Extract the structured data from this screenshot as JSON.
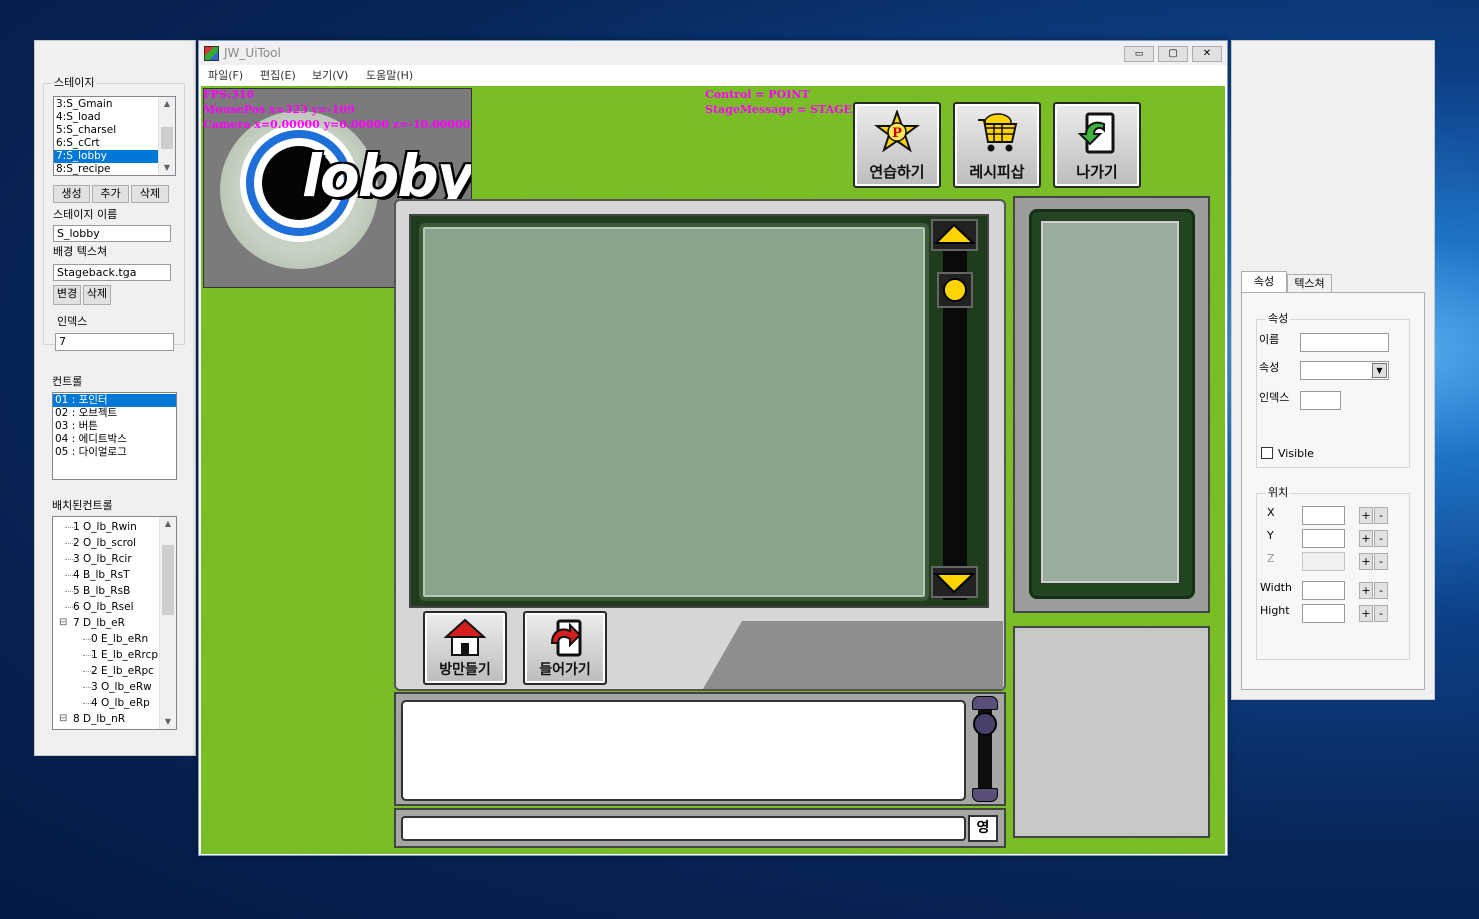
{
  "left_panel": {
    "stage_group_title": "스테이지",
    "stage_list": [
      "3:S_Gmain",
      "4:S_load",
      "5:S_charsel",
      "6:S_cCrt",
      "7:S_lobby",
      "8:S_recipe"
    ],
    "stage_selected_index": 4,
    "btn_create": "생성",
    "btn_add": "추가",
    "btn_delete": "삭제",
    "stage_name_label": "스테이지 이름",
    "stage_name_value": "S_lobby",
    "bg_texture_label": "배경 텍스쳐",
    "bg_texture_value": "Stageback.tga",
    "btn_change": "변경",
    "btn_delete2": "삭제",
    "index_label": "인덱스",
    "index_value": "7",
    "control_label": "컨트롤",
    "control_list": [
      "01 : 포인터",
      "02 : 오브젝트",
      "03 : 버튼",
      "04 : 에디트박스",
      "05 : 다이얼로그"
    ],
    "control_selected_index": 0,
    "placed_label": "배치된컨트롤",
    "tree": [
      {
        "text": "1 O_lb_Rwin",
        "level": 1,
        "expand": ""
      },
      {
        "text": "2 O_lb_scrol",
        "level": 1,
        "expand": ""
      },
      {
        "text": "3 O_lb_Rcir",
        "level": 1,
        "expand": ""
      },
      {
        "text": "4 B_lb_RsT",
        "level": 1,
        "expand": ""
      },
      {
        "text": "5 B_lb_RsB",
        "level": 1,
        "expand": ""
      },
      {
        "text": "6 O_lb_Rsel",
        "level": 1,
        "expand": ""
      },
      {
        "text": "7 D_lb_eR",
        "level": 1,
        "expand": "⊟"
      },
      {
        "text": "0 E_lb_eRn",
        "level": 2,
        "expand": ""
      },
      {
        "text": "1 E_lb_eRrcp",
        "level": 2,
        "expand": ""
      },
      {
        "text": "2 E_lb_eRpc",
        "level": 2,
        "expand": ""
      },
      {
        "text": "3 O_lb_eRw",
        "level": 2,
        "expand": ""
      },
      {
        "text": "4 O_lb_eRp",
        "level": 2,
        "expand": ""
      },
      {
        "text": "8 D_lb_nR",
        "level": 1,
        "expand": "⊟"
      }
    ]
  },
  "main_window": {
    "title": "JW_UiTool",
    "menu": [
      "파일(F)",
      "편집(E)",
      "보기(V)",
      "도움말(H)"
    ],
    "ctrl_min": "▭",
    "ctrl_max": "▢",
    "ctrl_close": "✕"
  },
  "canvas": {
    "debug_fps": "FPS:316",
    "debug_mouse": "MousePos x=323 y=-109",
    "debug_camera": "Camera x=0.00000 y=0.00000 z=-10.00000",
    "debug_control": "Control = POINT",
    "debug_stage_msg": "StageMessage = STAGEMSG_NULL",
    "logo_text": "lobby",
    "btn_practice": "연습하기",
    "btn_recipe": "레시피삽",
    "btn_exit": "나가기",
    "btn_make_room": "방만들기",
    "btn_enter": "들어가기",
    "lang_toggle": "영",
    "colors": {
      "green": "#7cc126",
      "frame_dark": "#1f3d1c",
      "screen": "#8aa38b",
      "magenta": "#ff00ff",
      "yellow": "#ffd400"
    }
  },
  "right_panel": {
    "tab_props": "속성",
    "tab_texture": "텍스쳐",
    "props_group": "속성",
    "name_label": "이름",
    "name_value": "",
    "attr_label": "속성",
    "attr_value": "",
    "index_label": "인덱스",
    "index_value": "",
    "visible_label": "Visible",
    "visible_checked": false,
    "pos_group": "위치",
    "x_label": "X",
    "y_label": "Y",
    "z_label": "Z",
    "width_label": "Width",
    "height_label": "Hight",
    "plus": "+",
    "minus": "-"
  }
}
